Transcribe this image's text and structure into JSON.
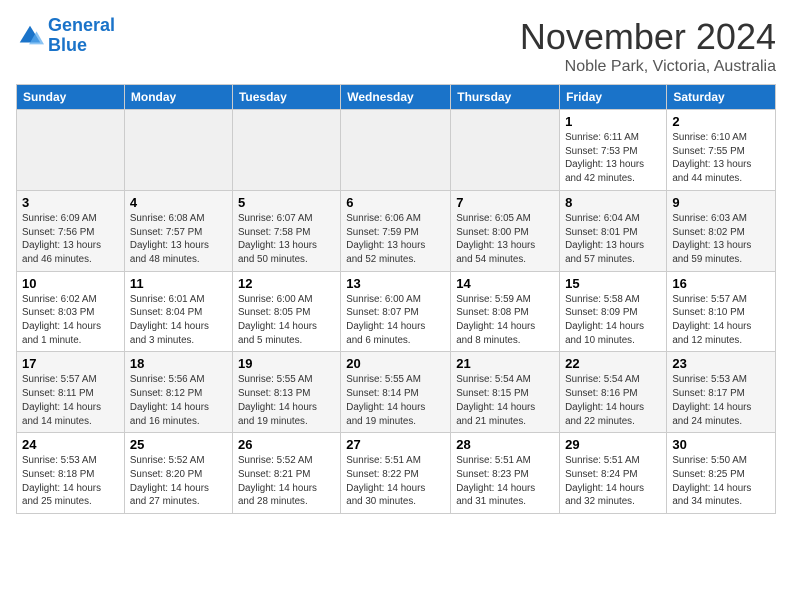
{
  "app": {
    "logo_line1": "General",
    "logo_line2": "Blue",
    "month": "November 2024",
    "location": "Noble Park, Victoria, Australia"
  },
  "calendar": {
    "headers": [
      "Sunday",
      "Monday",
      "Tuesday",
      "Wednesday",
      "Thursday",
      "Friday",
      "Saturday"
    ],
    "rows": [
      [
        {
          "day": "",
          "info": ""
        },
        {
          "day": "",
          "info": ""
        },
        {
          "day": "",
          "info": ""
        },
        {
          "day": "",
          "info": ""
        },
        {
          "day": "",
          "info": ""
        },
        {
          "day": "1",
          "info": "Sunrise: 6:11 AM\nSunset: 7:53 PM\nDaylight: 13 hours\nand 42 minutes."
        },
        {
          "day": "2",
          "info": "Sunrise: 6:10 AM\nSunset: 7:55 PM\nDaylight: 13 hours\nand 44 minutes."
        }
      ],
      [
        {
          "day": "3",
          "info": "Sunrise: 6:09 AM\nSunset: 7:56 PM\nDaylight: 13 hours\nand 46 minutes."
        },
        {
          "day": "4",
          "info": "Sunrise: 6:08 AM\nSunset: 7:57 PM\nDaylight: 13 hours\nand 48 minutes."
        },
        {
          "day": "5",
          "info": "Sunrise: 6:07 AM\nSunset: 7:58 PM\nDaylight: 13 hours\nand 50 minutes."
        },
        {
          "day": "6",
          "info": "Sunrise: 6:06 AM\nSunset: 7:59 PM\nDaylight: 13 hours\nand 52 minutes."
        },
        {
          "day": "7",
          "info": "Sunrise: 6:05 AM\nSunset: 8:00 PM\nDaylight: 13 hours\nand 54 minutes."
        },
        {
          "day": "8",
          "info": "Sunrise: 6:04 AM\nSunset: 8:01 PM\nDaylight: 13 hours\nand 57 minutes."
        },
        {
          "day": "9",
          "info": "Sunrise: 6:03 AM\nSunset: 8:02 PM\nDaylight: 13 hours\nand 59 minutes."
        }
      ],
      [
        {
          "day": "10",
          "info": "Sunrise: 6:02 AM\nSunset: 8:03 PM\nDaylight: 14 hours\nand 1 minute."
        },
        {
          "day": "11",
          "info": "Sunrise: 6:01 AM\nSunset: 8:04 PM\nDaylight: 14 hours\nand 3 minutes."
        },
        {
          "day": "12",
          "info": "Sunrise: 6:00 AM\nSunset: 8:05 PM\nDaylight: 14 hours\nand 5 minutes."
        },
        {
          "day": "13",
          "info": "Sunrise: 6:00 AM\nSunset: 8:07 PM\nDaylight: 14 hours\nand 6 minutes."
        },
        {
          "day": "14",
          "info": "Sunrise: 5:59 AM\nSunset: 8:08 PM\nDaylight: 14 hours\nand 8 minutes."
        },
        {
          "day": "15",
          "info": "Sunrise: 5:58 AM\nSunset: 8:09 PM\nDaylight: 14 hours\nand 10 minutes."
        },
        {
          "day": "16",
          "info": "Sunrise: 5:57 AM\nSunset: 8:10 PM\nDaylight: 14 hours\nand 12 minutes."
        }
      ],
      [
        {
          "day": "17",
          "info": "Sunrise: 5:57 AM\nSunset: 8:11 PM\nDaylight: 14 hours\nand 14 minutes."
        },
        {
          "day": "18",
          "info": "Sunrise: 5:56 AM\nSunset: 8:12 PM\nDaylight: 14 hours\nand 16 minutes."
        },
        {
          "day": "19",
          "info": "Sunrise: 5:55 AM\nSunset: 8:13 PM\nDaylight: 14 hours\nand 19 minutes."
        },
        {
          "day": "20",
          "info": "Sunrise: 5:55 AM\nSunset: 8:14 PM\nDaylight: 14 hours\nand 19 minutes."
        },
        {
          "day": "21",
          "info": "Sunrise: 5:54 AM\nSunset: 8:15 PM\nDaylight: 14 hours\nand 21 minutes."
        },
        {
          "day": "22",
          "info": "Sunrise: 5:54 AM\nSunset: 8:16 PM\nDaylight: 14 hours\nand 22 minutes."
        },
        {
          "day": "23",
          "info": "Sunrise: 5:53 AM\nSunset: 8:17 PM\nDaylight: 14 hours\nand 24 minutes."
        }
      ],
      [
        {
          "day": "24",
          "info": "Sunrise: 5:53 AM\nSunset: 8:18 PM\nDaylight: 14 hours\nand 25 minutes."
        },
        {
          "day": "25",
          "info": "Sunrise: 5:52 AM\nSunset: 8:20 PM\nDaylight: 14 hours\nand 27 minutes."
        },
        {
          "day": "26",
          "info": "Sunrise: 5:52 AM\nSunset: 8:21 PM\nDaylight: 14 hours\nand 28 minutes."
        },
        {
          "day": "27",
          "info": "Sunrise: 5:51 AM\nSunset: 8:22 PM\nDaylight: 14 hours\nand 30 minutes."
        },
        {
          "day": "28",
          "info": "Sunrise: 5:51 AM\nSunset: 8:23 PM\nDaylight: 14 hours\nand 31 minutes."
        },
        {
          "day": "29",
          "info": "Sunrise: 5:51 AM\nSunset: 8:24 PM\nDaylight: 14 hours\nand 32 minutes."
        },
        {
          "day": "30",
          "info": "Sunrise: 5:50 AM\nSunset: 8:25 PM\nDaylight: 14 hours\nand 34 minutes."
        }
      ]
    ]
  }
}
